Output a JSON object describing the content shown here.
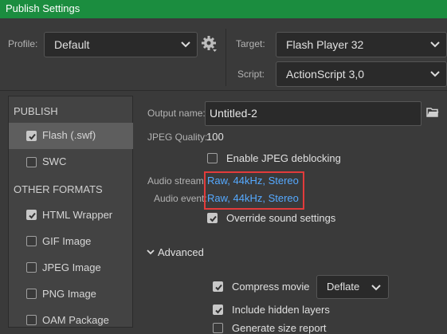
{
  "window": {
    "title": "Publish Settings"
  },
  "profile": {
    "label": "Profile:",
    "value": "Default"
  },
  "target": {
    "label": "Target:",
    "value": "Flash Player 32"
  },
  "script": {
    "label": "Script:",
    "value": "ActionScript 3,0"
  },
  "sidebar": {
    "publish_header": "PUBLISH",
    "publish_items": [
      {
        "label": "Flash (.swf)",
        "checked": true,
        "selected": true
      },
      {
        "label": "SWC",
        "checked": false,
        "selected": false
      }
    ],
    "other_header": "OTHER FORMATS",
    "other_items": [
      {
        "label": "HTML Wrapper",
        "checked": true
      },
      {
        "label": "GIF Image",
        "checked": false
      },
      {
        "label": "JPEG Image",
        "checked": false
      },
      {
        "label": "PNG Image",
        "checked": false
      },
      {
        "label": "OAM Package",
        "checked": false
      }
    ]
  },
  "main": {
    "output_name_label": "Output name:",
    "output_name_value": "Untitled-2",
    "jpeg_quality_label": "JPEG Quality:",
    "jpeg_quality_value": "100",
    "enable_deblocking_label": "Enable JPEG deblocking",
    "audio_stream_label": "Audio stream:",
    "audio_stream_value": "Raw, 44kHz, Stereo",
    "audio_event_label": "Audio event:",
    "audio_event_value": "Raw, 44kHz, Stereo",
    "override_sound_label": "Override sound settings",
    "advanced_label": "Advanced",
    "compress_movie_label": "Compress movie",
    "compress_mode_value": "Deflate",
    "include_hidden_label": "Include hidden layers",
    "size_report_label": "Generate size report"
  },
  "colors": {
    "title_bar": "#1b8d3f",
    "link": "#55a9ff",
    "highlight_box": "#e23b3b"
  }
}
